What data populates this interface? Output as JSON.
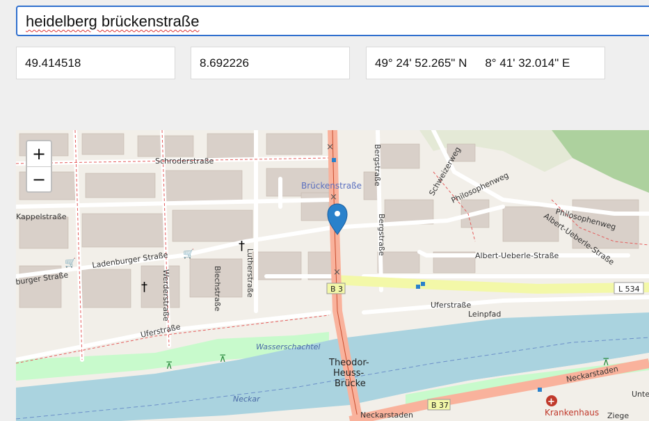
{
  "search": {
    "value": "heidelberg brückenstraße"
  },
  "coords": {
    "latitude": "49.414518",
    "longitude": "8.692226",
    "dms_lat": "49° 24' 52.265\" N",
    "dms_lon": "8° 41' 32.014\" E"
  },
  "map": {
    "zoom_in": "+",
    "zoom_out": "−",
    "marker_icon": "map-pin-icon",
    "labels": {
      "schroderstrasse": "Schroderstraße",
      "brueckenstrasse": "Brückenstraße",
      "bergstrasse_top": "Bergstraße",
      "bergstrasse_mid": "Bergstraße",
      "schweizerweg": "Schweizerweg",
      "philosophenweg_1": "Philosophenweg",
      "philosophenweg_2": "Philosophenweg",
      "albert_ueberle_diag": "Albert-Ueberle-Straße",
      "albert_ueberle": "Albert-Ueberle-Straße",
      "kappelstrasse": "Kappelstraße",
      "ladenburger": "Ladenburger Straße",
      "burger": "burger Straße",
      "werderstrasse": "Werderstraße",
      "blechstrasse": "Blechstraße",
      "lutherstrasse": "Lutherstraße",
      "uferstrasse_left": "Uferstraße",
      "uferstrasse_right": "Uferstraße",
      "leinpfad": "Leinpfad",
      "wasserschachtel": "Wasserschachtel",
      "theodor_1": "Theodor-",
      "theodor_2": "Heuss-",
      "theodor_3": "Brücke",
      "neckar": "Neckar",
      "neckarstaden_left": "Neckarstaden",
      "neckarstaden_right": "Neckarstaden",
      "b3": "B 3",
      "b37": "B 37",
      "l534": "L 534",
      "krankenhaus": "Krankenhaus",
      "unte": "Unte",
      "ziege": "Ziege"
    },
    "colors": {
      "water": "#aad3df",
      "park": "#c8facc",
      "wood": "#add19e",
      "trunk": "#f9b29c",
      "primary_yellow": "#f3f8a8",
      "building": "#d9d0c9",
      "marker": "#2a81cb"
    }
  }
}
